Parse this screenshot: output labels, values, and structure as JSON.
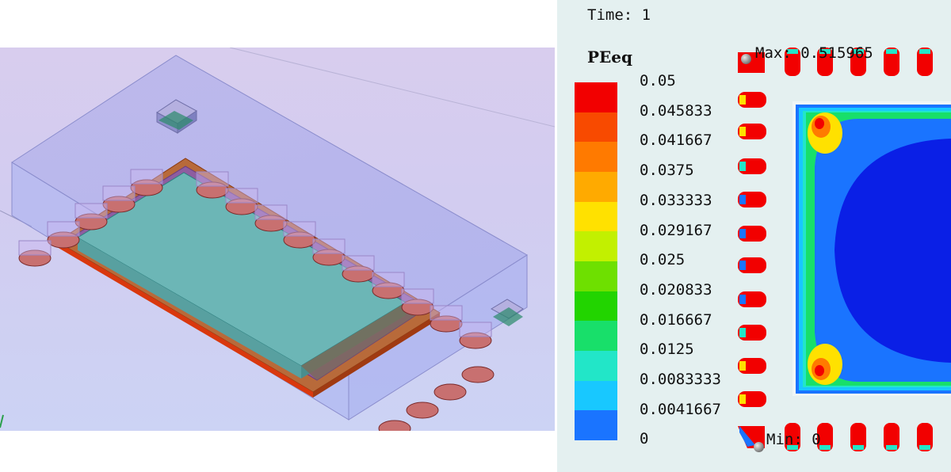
{
  "time_label": "Time: 1",
  "legend": {
    "title": "PEeq",
    "ticks": [
      "0.05",
      "0.045833",
      "0.041667",
      "0.0375",
      "0.033333",
      "0.029167",
      "0.025",
      "0.020833",
      "0.016667",
      "0.0125",
      "0.0083333",
      "0.0041667",
      "0"
    ],
    "colors": [
      "#f20000",
      "#f84a00",
      "#ff7a00",
      "#ffaa00",
      "#ffe100",
      "#c2f000",
      "#6ee000",
      "#22d400",
      "#18df6a",
      "#22e6c8",
      "#18c8ff",
      "#1a74ff",
      "#0a1fe6"
    ]
  },
  "max_label": "Max: 0.515965",
  "min_label": "Min: 0",
  "colors": {
    "background_3d": "#d4cdf0",
    "panel_bg": "#e4f0f0",
    "die": "#6fb3b3",
    "leadframe": "#c8501a",
    "pad": "#c76b6b",
    "mold": "#9aa6e6"
  }
}
